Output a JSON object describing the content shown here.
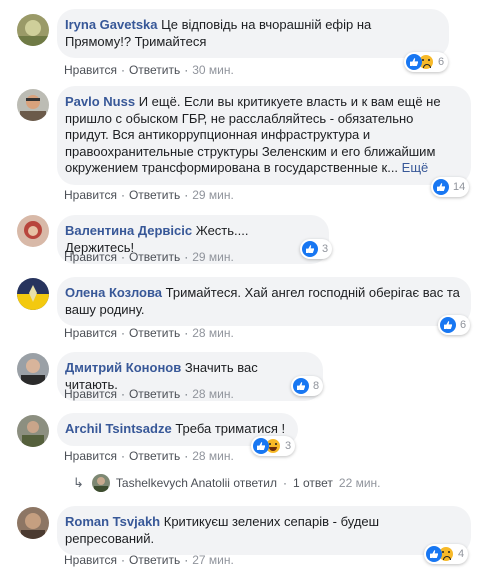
{
  "actions": {
    "like": "Нравится",
    "reply": "Ответить",
    "sep": "·"
  },
  "colors": {
    "author": "#385898",
    "bubble": "#f2f3f5",
    "like": "#1877f2",
    "emoji": "#f7b928"
  },
  "comments": [
    {
      "author": "Iryna Gavetska",
      "text": "Це відповідь на вчорашній ефір на Прямому!? Тримайтеся",
      "time": "30 мин.",
      "reactions": [
        "like",
        "sad"
      ],
      "count": "6"
    },
    {
      "author": "Pavlo Nuss",
      "text": "И ещё. Если вы критикуете власть и к вам ещё не пришло с обыском ГБР, не расслабляйтесь - обязательно придут. Вся антикоррупционная инфраструктура и правоохранительные структуры Зеленским и его ближайшим окружением трансформирована в государственные к...",
      "more": "Ещё",
      "time": "29 мин.",
      "reactions": [
        "like"
      ],
      "count": "14"
    },
    {
      "author": "Валентина Дервісіс",
      "text": "Жесть.... Держитесь!",
      "time": "29 мин.",
      "reactions": [
        "like"
      ],
      "count": "3"
    },
    {
      "author": "Олена Козлова",
      "text": "Тримайтеся. Хай ангел господній оберігає вас та вашу родину.",
      "time": "28 мин.",
      "reactions": [
        "like"
      ],
      "count": "6"
    },
    {
      "author": "Дмитрий Кононов",
      "text": "Значить вас читають.",
      "time": "28 мин.",
      "reactions": [
        "like"
      ],
      "count": "8"
    },
    {
      "author": "Archil Tsintsadze",
      "text": "Треба триматися !",
      "time": "28 мин.",
      "reactions": [
        "like",
        "haha"
      ],
      "count": "3"
    },
    {
      "author": "Roman Tsvjakh",
      "text": "Критикуєш зелених сепарів - будеш репресований.",
      "time": "27 мин.",
      "reactions": [
        "like",
        "sad"
      ],
      "count": "4"
    }
  ],
  "reply_summary": {
    "name": "Tashelkevych Anatolii",
    "verb": "ответил",
    "count": "1 ответ",
    "time": "22 мин."
  }
}
